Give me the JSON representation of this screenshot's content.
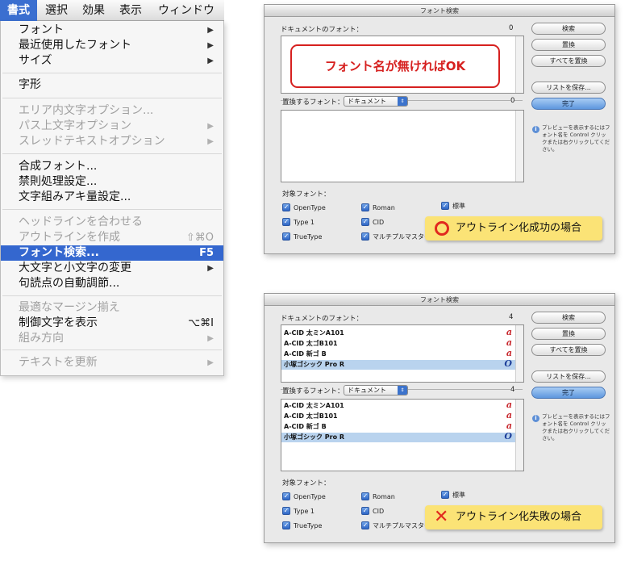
{
  "menubar": {
    "items": [
      "書式",
      "選択",
      "効果",
      "表示",
      "ウィンドウ"
    ],
    "active_index": 0
  },
  "menu": {
    "items": [
      {
        "label": "フォント",
        "submenu": true,
        "enabled": true
      },
      {
        "label": "最近使用したフォント",
        "submenu": true,
        "enabled": true
      },
      {
        "label": "サイズ",
        "submenu": true,
        "enabled": true
      },
      {
        "label": "字形",
        "enabled": true
      },
      {
        "label": "エリア内文字オプション...",
        "enabled": false
      },
      {
        "label": "パス上文字オプション",
        "submenu": true,
        "enabled": false
      },
      {
        "label": "スレッドテキストオプション",
        "submenu": true,
        "enabled": false
      },
      {
        "label": "合成フォント...",
        "enabled": true
      },
      {
        "label": "禁則処理設定...",
        "enabled": true
      },
      {
        "label": "文字組みアキ量設定...",
        "enabled": true
      },
      {
        "label": "ヘッドラインを合わせる",
        "enabled": false
      },
      {
        "label": "アウトラインを作成",
        "shortcut": "⇧⌘O",
        "enabled": false
      },
      {
        "label": "フォント検索...",
        "shortcut": "F5",
        "enabled": true,
        "highlighted": true
      },
      {
        "label": "大文字と小文字の変更",
        "submenu": true,
        "enabled": true
      },
      {
        "label": "句読点の自動調節...",
        "enabled": true
      },
      {
        "label": "最適なマージン揃え",
        "enabled": false
      },
      {
        "label": "制御文字を表示",
        "shortcut": "⌥⌘I",
        "enabled": true
      },
      {
        "label": "組み方向",
        "submenu": true,
        "enabled": false
      },
      {
        "label": "テキストを更新",
        "submenu": true,
        "enabled": false
      }
    ]
  },
  "dialog": {
    "title": "フォント検索",
    "doc_fonts_label": "ドキュメントのフォント：",
    "replace_label": "置換するフォント：",
    "replace_popup": "ドキュメント",
    "target_label": "対象フォント：",
    "buttons": {
      "find": "検索",
      "change": "置換",
      "change_all": "すべてを置換",
      "save_list": "リストを保存...",
      "done": "完了"
    },
    "hint": "プレビューを表示するにはフォント名を Control クリックまたは右クリックしてください。",
    "checkboxes": {
      "col1": [
        "OpenType",
        "Type 1",
        "TrueType"
      ],
      "col2": [
        "Roman",
        "CID",
        "マルチプルマスター"
      ],
      "col3": [
        "標準"
      ]
    }
  },
  "dialog1": {
    "doc_count": "0",
    "replace_count": "0",
    "callout_box": "フォント名が無ければOK",
    "result_tag": "アウトライン化成功の場合",
    "result_icon": "success-circle-icon",
    "result_color": "#e1291f"
  },
  "dialog2": {
    "doc_count": "4",
    "replace_count": "4",
    "doc_fonts": [
      {
        "name": "A-CID 太ミンA101",
        "glyph": "a"
      },
      {
        "name": "A-CID 太ゴB101",
        "glyph": "a"
      },
      {
        "name": "A-CID 新ゴ B",
        "glyph": "a"
      },
      {
        "name": "小塚ゴシック Pro R",
        "glyph": "O"
      }
    ],
    "replace_fonts": [
      {
        "name": "A-CID 太ミンA101",
        "glyph": "a"
      },
      {
        "name": "A-CID 太ゴB101",
        "glyph": "a"
      },
      {
        "name": "A-CID 新ゴ B",
        "glyph": "a"
      },
      {
        "name": "小塚ゴシック Pro R",
        "glyph": "O"
      }
    ],
    "result_tag": "アウトライン化失敗の場合",
    "result_icon": "failure-cross-icon",
    "result_glyph": "✕",
    "result_color": "#e1291f"
  }
}
